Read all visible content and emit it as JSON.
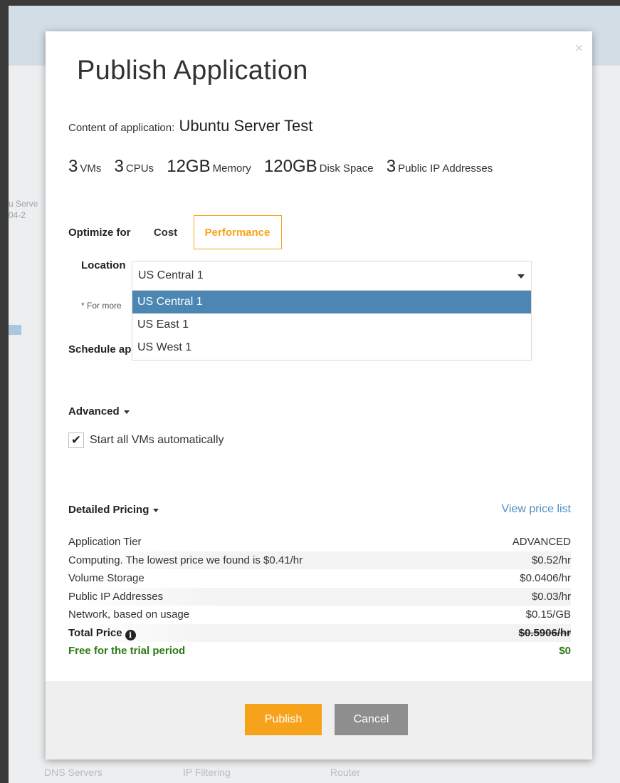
{
  "background": {
    "left_text_lines": [
      "u Serve",
      "04-2"
    ],
    "bottom_labels": [
      "DNS Servers",
      "IP Filtering",
      "Router"
    ]
  },
  "modal": {
    "title": "Publish Application",
    "close_icon": "close-icon",
    "content_label": "Content of application:",
    "app_name": "Ubuntu Server Test",
    "specs": [
      {
        "value": "3",
        "unit": "VMs"
      },
      {
        "value": "3",
        "unit": "CPUs"
      },
      {
        "value": "12GB",
        "unit": "Memory"
      },
      {
        "value": "120GB",
        "unit": "Disk Space"
      },
      {
        "value": "3",
        "unit": "Public IP Addresses"
      }
    ],
    "optimize": {
      "label": "Optimize for",
      "options": [
        "Cost",
        "Performance"
      ],
      "selected": "Performance"
    },
    "location": {
      "label": "Location",
      "value": "US Central 1",
      "options": [
        "US Central 1",
        "US East 1",
        "US West 1"
      ],
      "highlighted": "US Central 1"
    },
    "for_more_text": "* For more",
    "schedule_label": "Schedule ap",
    "advanced": {
      "label": "Advanced",
      "start_all_label": "Start all VMs automatically",
      "start_all_checked": true
    },
    "pricing": {
      "header": "Detailed Pricing",
      "view_link": "View price list",
      "rows": [
        {
          "label": "Application Tier",
          "value": "ADVANCED"
        },
        {
          "label": "Computing. The lowest price we found is $0.41/hr",
          "value": "$0.52/hr"
        },
        {
          "label": "Volume Storage",
          "value": "$0.0406/hr"
        },
        {
          "label": "Public IP Addresses",
          "value": "$0.03/hr"
        },
        {
          "label": "Network, based on usage",
          "value": "$0.15/GB"
        }
      ],
      "total_label": "Total Price",
      "total_value": "$0.5906/hr",
      "free_label": "Free for the trial period",
      "free_value": "$0"
    },
    "buttons": {
      "publish": "Publish",
      "cancel": "Cancel"
    },
    "colors": {
      "accent": "#f7a21b",
      "selected_option": "#4b87b2",
      "link": "#4f8fc1",
      "free_green": "#2c7a12",
      "cancel_gray": "#8e8e8e"
    }
  }
}
